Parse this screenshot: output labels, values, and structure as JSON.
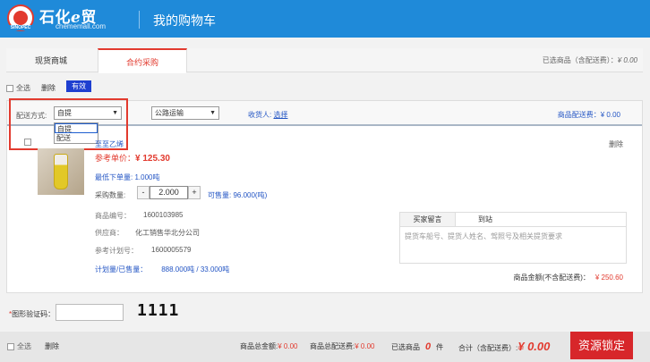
{
  "header": {
    "brand": "石化",
    "brand_e": "e",
    "brand_suffix": "贸",
    "logo_tag": "SINOPEC",
    "domain": "chememall.com",
    "page_title": "我的购物车"
  },
  "tabs": [
    {
      "label": "现货商城",
      "active": false
    },
    {
      "label": "合约采购",
      "active": true
    }
  ],
  "summary": {
    "label": "已选商品（含配送费）：",
    "value": "¥ 0.00"
  },
  "actions": {
    "select_all": "全选",
    "delete": "删除",
    "valid": "有效"
  },
  "shipping": {
    "method_label": "配送方式:",
    "method_value": "自提",
    "method_options": [
      "自提",
      "配送"
    ],
    "transport_value": "公路运输",
    "receiver_label": "收货人:",
    "receiver_link": "选择",
    "fee": "商品配送费：¥ 0.00"
  },
  "item": {
    "name": "至至乙烯",
    "delete": "删除",
    "ref_price_label": "参考单价：",
    "ref_price_value": "¥ 125.30",
    "min_order": "最低下单量: 1.000吨",
    "qty_label": "采购数量:",
    "qty_minus": "-",
    "qty_value": "2.000",
    "qty_plus": "+",
    "available": "可售量: 96.000(吨)",
    "code_label": "商品编号：",
    "code_value": "1600103985",
    "supplier_label": "供应商：",
    "supplier_value": "化工销售华北分公司",
    "plan_label": "参考计划号：",
    "plan_value": "1600005579",
    "plan_qty_label": "计划量/已售量：",
    "plan_qty_value": "888.000吨 / 33.000吨",
    "msg_tab1": "买家留言",
    "msg_tab2": "到站",
    "msg_hint": "提货车船号、提货人姓名、驾照号及相关提货要求",
    "total_label": "商品金额(不含配送费)：",
    "total_value": "¥ 250.60"
  },
  "captcha": {
    "star": "*",
    "label": "图形验证码：",
    "code": "1111"
  },
  "footer": {
    "select_all": "全选",
    "delete": "删除",
    "goods_total_label": "商品总金额:",
    "goods_total_value": "¥ 0.00",
    "fee_total_label": "商品总配送费:",
    "fee_total_value": "¥ 0.00",
    "selected_label": "已选商品",
    "selected_count": "0",
    "selected_unit": "件",
    "grand_label": "合计（含配送费）:",
    "grand_value": "¥ 0.00",
    "lock_button": "资源锁定"
  }
}
